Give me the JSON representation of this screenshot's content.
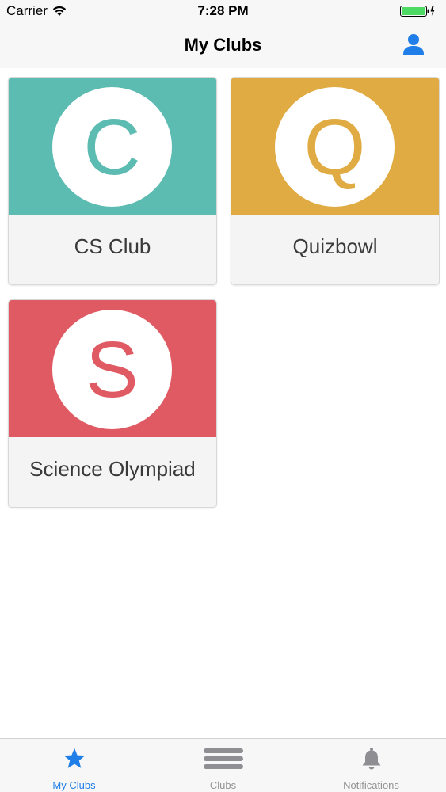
{
  "status_bar": {
    "carrier": "Carrier",
    "time": "7:28 PM",
    "battery_level": 1.0,
    "battery_color": "#4cd964"
  },
  "nav": {
    "title": "My Clubs",
    "profile_icon": "person-icon",
    "accent": "#1f7ee8"
  },
  "clubs": [
    {
      "letter": "C",
      "name": "CS Club",
      "color": "#5dbcb2"
    },
    {
      "letter": "Q",
      "name": "Quizbowl",
      "color": "#dfab42"
    },
    {
      "letter": "S",
      "name": "Science Olympiad",
      "color": "#e05a63"
    }
  ],
  "tabs": [
    {
      "label": "My Clubs",
      "icon": "star-icon",
      "active": true
    },
    {
      "label": "Clubs",
      "icon": "list-icon",
      "active": false
    },
    {
      "label": "Notifications",
      "icon": "bell-icon",
      "active": false
    }
  ]
}
